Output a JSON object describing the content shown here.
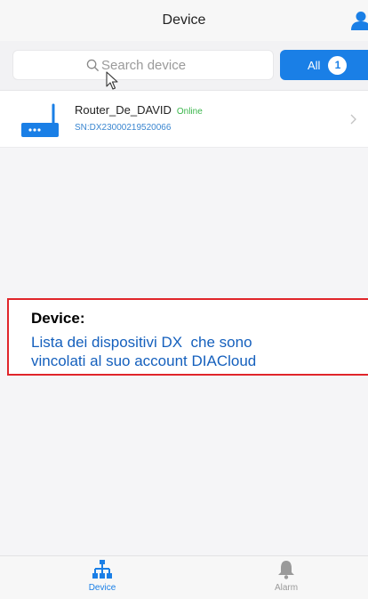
{
  "header": {
    "title": "Device",
    "user_icon": "user-icon"
  },
  "search": {
    "placeholder": "Search device",
    "icon": "search-icon"
  },
  "filter": {
    "all_label": "All",
    "count": "1",
    "accent": "#1a7fe6"
  },
  "devices": [
    {
      "name": "Router_De_DAVID",
      "status": "Online",
      "sn": "SN:DX23000219520066",
      "icon": "router-icon"
    }
  ],
  "callout": {
    "title": "Device:",
    "text": "Lista dei dispositivi DX  che sono\nvincolati al suo account DIACloud"
  },
  "tabbar": {
    "items": [
      {
        "label": "Device",
        "icon": "network-icon",
        "active": true
      },
      {
        "label": "Alarm",
        "icon": "bell-icon",
        "active": false
      }
    ]
  },
  "colors": {
    "online": "#39b54a",
    "sn": "#3a86d0",
    "callout_border": "#e0252a"
  }
}
